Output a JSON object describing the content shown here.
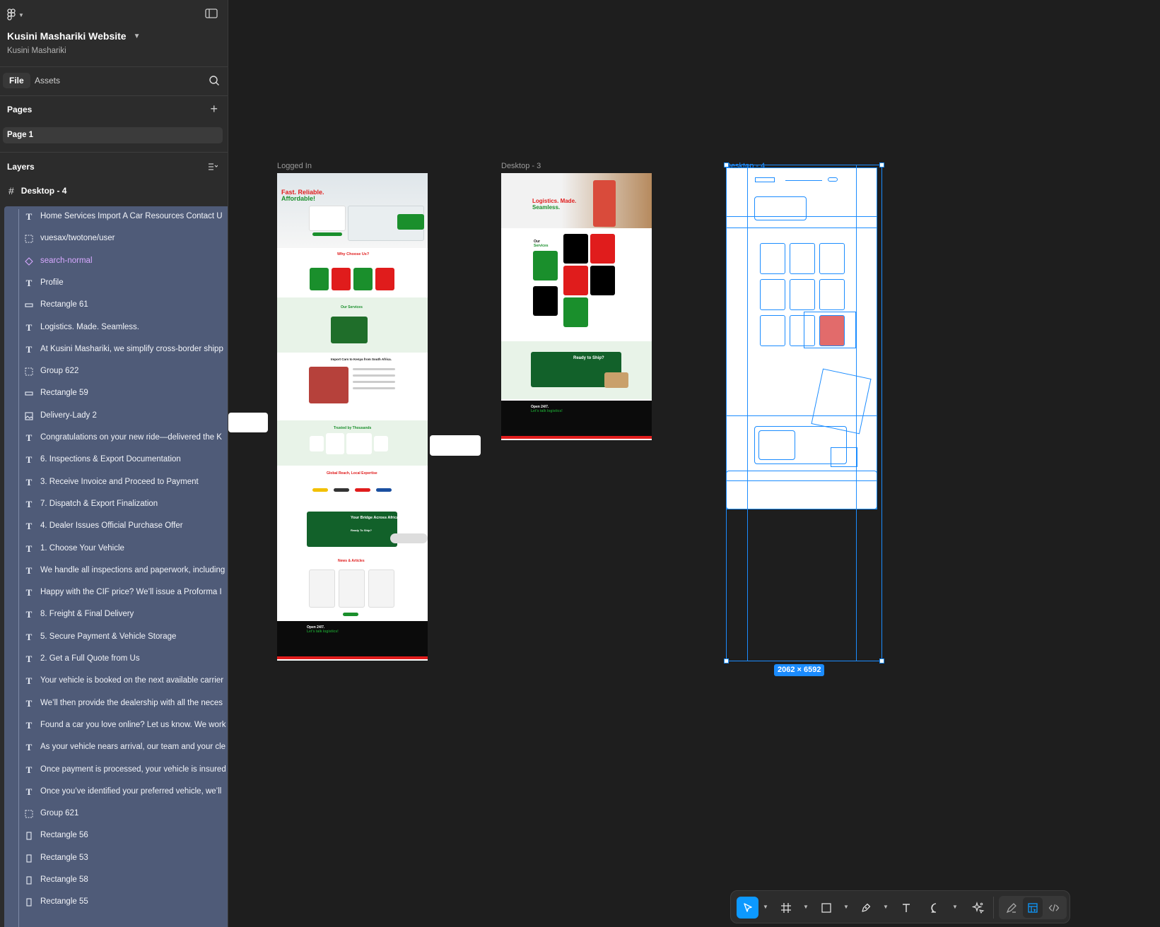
{
  "file": {
    "name": "Kusini Mashariki Website",
    "team": "Kusini Mashariki"
  },
  "panel_tabs": {
    "file": "File",
    "assets": "Assets"
  },
  "pages": {
    "title": "Pages",
    "items": [
      "Page 1"
    ]
  },
  "layers": {
    "title": "Layers",
    "frame": "Desktop - 4",
    "items": [
      {
        "type": "text",
        "name": "Home Services Import A Car Resources Contact U"
      },
      {
        "type": "group",
        "name": "vuesax/twotone/user"
      },
      {
        "type": "component",
        "name": "search-normal"
      },
      {
        "type": "text",
        "name": "Profile"
      },
      {
        "type": "rect-h",
        "name": "Rectangle 61"
      },
      {
        "type": "text",
        "name": "Logistics. Made. Seamless."
      },
      {
        "type": "text",
        "name": "At Kusini Mashariki, we simplify cross-border shipp"
      },
      {
        "type": "group",
        "name": "Group 622"
      },
      {
        "type": "rect-h",
        "name": "Rectangle 59"
      },
      {
        "type": "image",
        "name": "Delivery-Lady 2"
      },
      {
        "type": "text",
        "name": "Congratulations on your new ride—delivered the K"
      },
      {
        "type": "text",
        "name": "6. Inspections & Export Documentation"
      },
      {
        "type": "text",
        "name": "3. Receive Invoice and Proceed to Payment"
      },
      {
        "type": "text",
        "name": "7. Dispatch & Export Finalization"
      },
      {
        "type": "text",
        "name": "4. Dealer Issues Official Purchase Offer"
      },
      {
        "type": "text",
        "name": "1. Choose Your Vehicle"
      },
      {
        "type": "text",
        "name": "We handle all inspections and paperwork, including"
      },
      {
        "type": "text",
        "name": "Happy with the CIF price? We’ll issue a Proforma I"
      },
      {
        "type": "text",
        "name": "8. Freight & Final Delivery"
      },
      {
        "type": "text",
        "name": "5. Secure Payment & Vehicle Storage"
      },
      {
        "type": "text",
        "name": "2. Get a Full Quote from Us"
      },
      {
        "type": "text",
        "name": "Your vehicle is booked on the next available carrier"
      },
      {
        "type": "text",
        "name": "We’ll then provide the dealership with all the neces"
      },
      {
        "type": "text",
        "name": "Found a car you love online? Let us know. We work"
      },
      {
        "type": "text",
        "name": "As your vehicle nears arrival, our team and your cle"
      },
      {
        "type": "text",
        "name": "Once payment is processed, your vehicle is insured"
      },
      {
        "type": "text",
        "name": "Once you’ve identified your preferred vehicle, we’ll"
      },
      {
        "type": "group",
        "name": "Group 621"
      },
      {
        "type": "rect-v",
        "name": "Rectangle 56"
      },
      {
        "type": "rect-v",
        "name": "Rectangle 53"
      },
      {
        "type": "rect-v",
        "name": "Rectangle 58"
      },
      {
        "type": "rect-v",
        "name": "Rectangle 55"
      }
    ]
  },
  "canvas": {
    "frames": [
      {
        "label": "Logged In",
        "texts": {
          "hero_title_1": "Fast. Reliable.",
          "hero_title_2": "Affordable!",
          "why": "Why Choose Us?",
          "services": "Our Services",
          "import": "Import Cars to Kenya from South Africa.",
          "trusted": "Trusted by Thousands",
          "global": "Global Reach, Local Expertise",
          "bridge": "Your Bridge Across Africa.",
          "ready": "Ready To Ship?",
          "news": "News & Articles",
          "open": "Open 24/7.",
          "talk": "Let's talk logistics!"
        }
      },
      {
        "label": "Desktop - 3",
        "texts": {
          "hero_title_1": "Logistics. Made.",
          "hero_title_2": "Seamless.",
          "services_1": "Our",
          "services_2": "Services",
          "ready": "Ready to Ship?",
          "open": "Open 24/7.",
          "talk": "Let's talk logistics!"
        }
      },
      {
        "label": "Desktop - 4",
        "dimensions": "2062 × 6592"
      }
    ]
  },
  "colors": {
    "brand_green": "#1a8f2c",
    "brand_red": "#e01c1c",
    "selection_blue": "#1b8cff",
    "layers_highlight": "#4f5b78"
  }
}
